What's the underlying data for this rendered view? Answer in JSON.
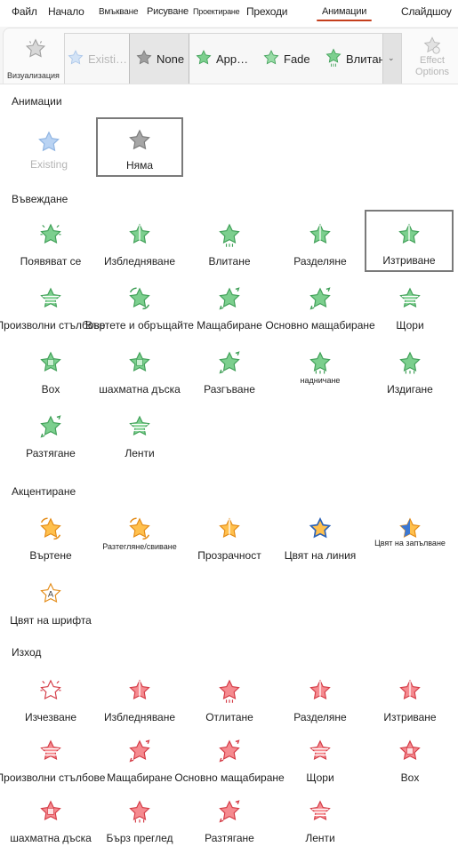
{
  "tabs": [
    {
      "label": "Файл",
      "active": false
    },
    {
      "label": "Начало",
      "active": false
    },
    {
      "label": "Вмъкване",
      "active": false
    },
    {
      "label": "Рисуване",
      "active": false
    },
    {
      "label": "Проектиране",
      "active": false
    },
    {
      "label": "Преходи",
      "active": false
    },
    {
      "label": "Анимации",
      "active": true
    },
    {
      "label": "Слайдшоу",
      "active": false
    }
  ],
  "ribbon": {
    "preview_label": "Визуализация",
    "effect_options_label": "Effect Options",
    "gallery": [
      {
        "label": "Existi…",
        "icon": "star-blue-icon",
        "state": "faded"
      },
      {
        "label": "None",
        "icon": "star-gray-icon",
        "state": "selected"
      },
      {
        "label": "App…",
        "icon": "star-green-icon",
        "state": "normal"
      },
      {
        "label": "Fade",
        "icon": "star-green-icon",
        "state": "normal"
      },
      {
        "label": "Влитане",
        "icon": "star-green-fly-icon",
        "state": "normal"
      }
    ]
  },
  "sections": {
    "animations": "Анимации",
    "entrance": "Въвеждане",
    "emphasis": "Акцентиране",
    "exit": "Изход"
  },
  "animations": [
    {
      "label": "Existing",
      "icon": "star-blue-icon",
      "faded": true
    },
    {
      "label": "Няма",
      "icon": "star-gray-icon",
      "selected": true
    }
  ],
  "entrance": [
    {
      "label": "Появяват се",
      "icon": "star-green-appear-icon"
    },
    {
      "label": "Избледняване",
      "icon": "star-green-fade-icon"
    },
    {
      "label": "Влитане",
      "icon": "star-green-fly-icon"
    },
    {
      "label": "Разделяне",
      "icon": "star-green-split-icon"
    },
    {
      "label": "Изтриване",
      "icon": "star-green-wipe-icon",
      "selected": true
    },
    {
      "label": "Произволни стълбове",
      "icon": "star-green-bars-icon"
    },
    {
      "label": "Въртете и обръщайте",
      "icon": "star-green-spin-icon"
    },
    {
      "label": "Мащабиране",
      "icon": "star-green-zoom-icon"
    },
    {
      "label": "Основно мащабиране",
      "icon": "star-green-basiczoom-icon"
    },
    {
      "label": "Щори",
      "icon": "star-green-blinds-icon"
    },
    {
      "label": "Box",
      "icon": "star-green-box-icon"
    },
    {
      "label": "шахматна дъска",
      "icon": "star-green-checker-icon"
    },
    {
      "label": "Разгъване",
      "icon": "star-green-expand-icon"
    },
    {
      "label": "надничане",
      "icon": "star-green-peek-icon",
      "tiny": true
    },
    {
      "label": "Издигане",
      "icon": "star-green-rise-icon"
    },
    {
      "label": "Разтягане",
      "icon": "star-green-stretch-icon"
    },
    {
      "label": "Ленти",
      "icon": "star-green-strips-icon"
    }
  ],
  "emphasis": [
    {
      "label": "Въртене",
      "icon": "star-orange-spin-icon"
    },
    {
      "label": "Разтегляне/свиване",
      "icon": "star-orange-grow-icon",
      "tiny": true
    },
    {
      "label": "Прозрачност",
      "icon": "star-orange-transparency-icon"
    },
    {
      "label": "Цвят на линия",
      "icon": "star-orange-linecolor-icon"
    },
    {
      "label": "Цвят на запълване",
      "icon": "star-orange-fillcolor-icon",
      "tiny2": true
    },
    {
      "label": "Цвят на шрифта",
      "icon": "star-orange-fontcolor-icon"
    }
  ],
  "exit": [
    {
      "label": "Изчезване",
      "icon": "star-red-disappear-icon"
    },
    {
      "label": "Избледняване",
      "icon": "star-red-fade-icon"
    },
    {
      "label": "Отлитане",
      "icon": "star-red-flyout-icon"
    },
    {
      "label": "Разделяне",
      "icon": "star-red-split-icon"
    },
    {
      "label": "Изтриване",
      "icon": "star-red-wipe-icon"
    },
    {
      "label": "Произволни стълбове",
      "icon": "star-red-bars-icon"
    },
    {
      "label": "Мащабиране",
      "icon": "star-red-zoom-icon"
    },
    {
      "label": "Основно мащабиране",
      "icon": "star-red-basiczoom-icon"
    },
    {
      "label": "Щори",
      "icon": "star-red-blinds-icon"
    },
    {
      "label": "Box",
      "icon": "star-red-box-icon"
    },
    {
      "label": "шахматна дъска",
      "icon": "star-red-checker-icon"
    },
    {
      "label": "Бърз преглед",
      "icon": "star-red-peek-icon"
    },
    {
      "label": "Разтягане",
      "icon": "star-red-stretch-icon"
    },
    {
      "label": "Ленти",
      "icon": "star-red-strips-icon"
    }
  ],
  "colors": {
    "accent_tab": "#c43e1c",
    "green_fill": "#7ccf8e",
    "green_stroke": "#3f9f57",
    "orange_fill": "#ffc04d",
    "orange_stroke": "#e38a14",
    "red_fill": "#f58a8f",
    "red_stroke": "#d43a45",
    "blue_fill": "#a8c8f0",
    "gray_fill": "#a0a0a0"
  }
}
